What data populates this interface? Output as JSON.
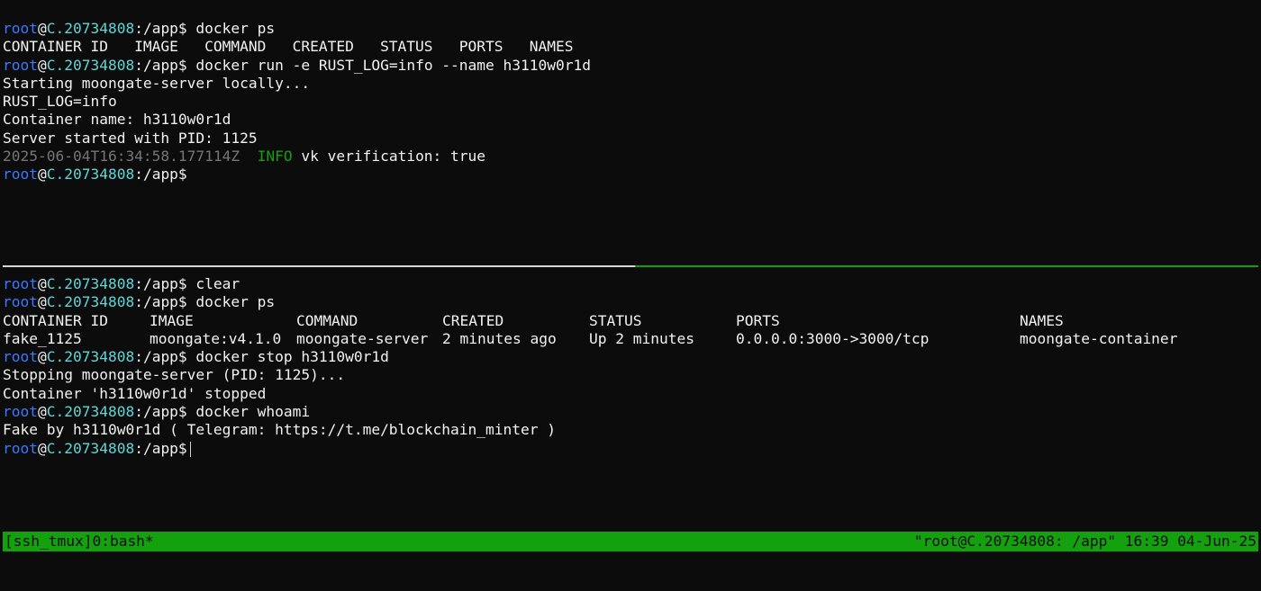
{
  "prompt": {
    "user": "root",
    "at": "@",
    "host": "C.20734808",
    "cwd": ":/app$"
  },
  "top_pane": {
    "cmd1": " docker ps",
    "ps_header_short": "CONTAINER ID   IMAGE   COMMAND   CREATED   STATUS   PORTS   NAMES",
    "cmd2": " docker run -e RUST_LOG=info --name h3110w0r1d",
    "out1": "Starting moongate-server locally...",
    "out2": "RUST_LOG=info",
    "out3": "Container name: h3110w0r1d",
    "out4": "Server started with PID: 1125",
    "log_timestamp": "2025-06-04T16:34:58.177114Z",
    "log_level": "INFO",
    "log_message": " vk verification: true"
  },
  "bottom_pane": {
    "cmd_clear": " clear",
    "cmd_ps": " docker ps",
    "table": {
      "headers": [
        "CONTAINER ID",
        "IMAGE",
        "COMMAND",
        "CREATED",
        "STATUS",
        "PORTS",
        "NAMES"
      ],
      "rows": [
        [
          "fake_1125",
          "moongate:v4.1.0",
          "moongate-server",
          "2 minutes ago",
          "Up 2 minutes",
          "0.0.0.0:3000->3000/tcp",
          "moongate-container"
        ]
      ]
    },
    "cmd_stop": " docker stop h3110w0r1d",
    "stop_out1": "Stopping moongate-server (PID: 1125)...",
    "stop_out2": "Container 'h3110w0r1d' stopped",
    "cmd_whoami": " docker whoami",
    "whoami_out": "Fake by h3110w0r1d ( Telegram: https://t.me/blockchain_minter )"
  },
  "status_bar": {
    "left": "[ssh_tmux]0:bash*",
    "right": "\"root@C.20734808: /app\" 16:39 04-Jun-25"
  },
  "colors": {
    "background": "#0c0c0c",
    "user": "#3b78ff",
    "host": "#61d6d6",
    "info": "#13a10e",
    "timestamp": "#767676",
    "status_bar": "#13a10e"
  }
}
